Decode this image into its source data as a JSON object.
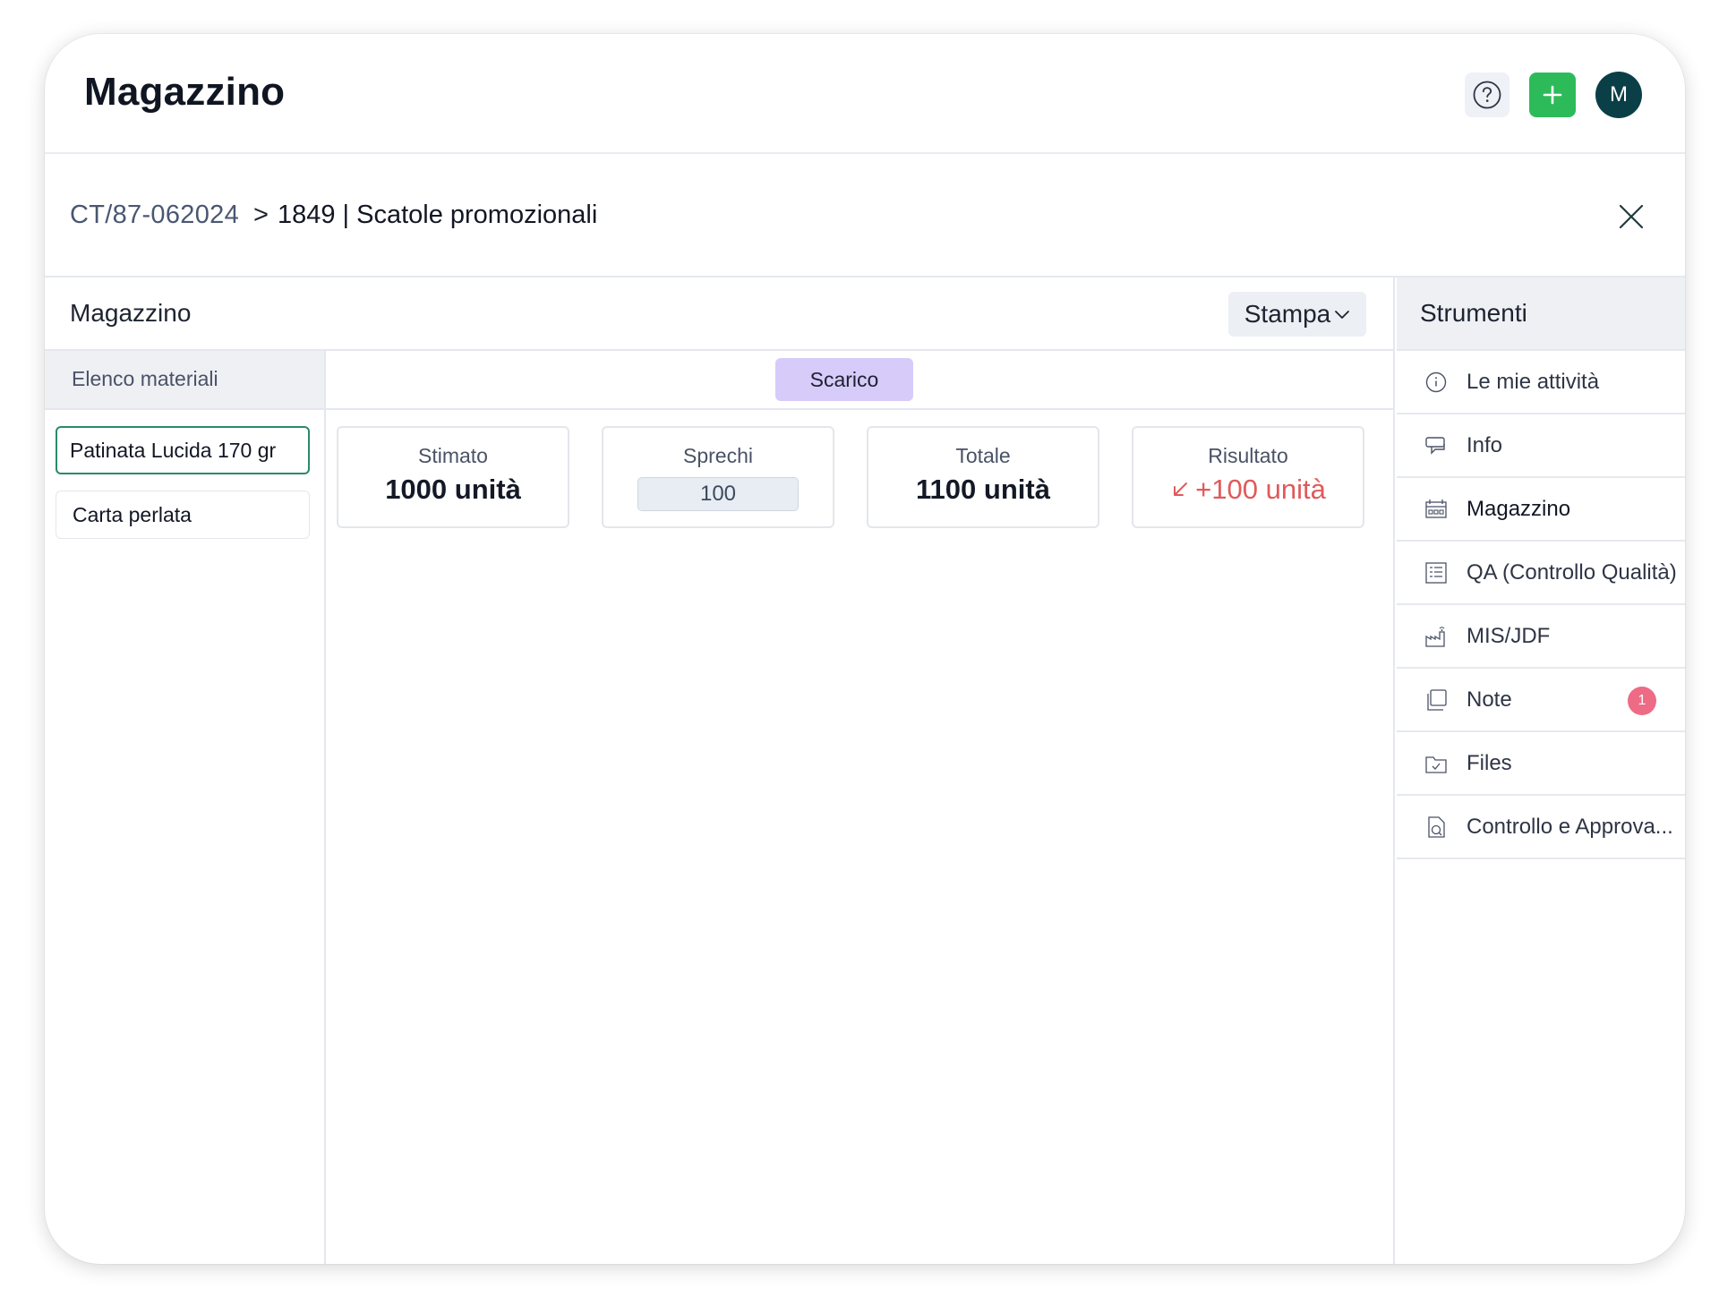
{
  "app": {
    "title": "Magazzino"
  },
  "header": {
    "avatar_initial": "M"
  },
  "breadcrumb": {
    "link": "CT/87-062024",
    "separator": ">",
    "current": "1849 | Scatole promozionali"
  },
  "main": {
    "title": "Magazzino",
    "stampa_label": "Stampa",
    "materials_header": "Elenco materiali",
    "materials": [
      {
        "label": "Patinata Lucida 170 gr",
        "active": true
      },
      {
        "label": "Carta perlata",
        "active": false
      }
    ],
    "tab": "Scarico",
    "stats": {
      "stimato": {
        "label": "Stimato",
        "value": "1000 unità"
      },
      "sprechi": {
        "label": "Sprechi",
        "value": "100"
      },
      "totale": {
        "label": "Totale",
        "value": "1100 unità"
      },
      "risultato": {
        "label": "Risultato",
        "value": "+100 unità",
        "color": "#e05a5a"
      }
    }
  },
  "tools": {
    "title": "Strumenti",
    "items": [
      {
        "label": "Le mie attività",
        "icon": "info-circle-icon"
      },
      {
        "label": "Info",
        "icon": "chat-icon"
      },
      {
        "label": "Magazzino",
        "icon": "warehouse-icon",
        "current": true
      },
      {
        "label": "QA (Controllo Qualità)",
        "icon": "checklist-icon"
      },
      {
        "label": "MIS/JDF",
        "icon": "factory-icon"
      },
      {
        "label": "Note",
        "icon": "note-icon",
        "badge": "1"
      },
      {
        "label": "Files",
        "icon": "folder-icon"
      },
      {
        "label": "Controllo e Approva...",
        "icon": "file-search-icon"
      }
    ]
  },
  "colors": {
    "accent_green": "#2dbb5a",
    "avatar": "#0b3f47",
    "tab_purple": "#d7cbfa",
    "badge": "#ee6b86"
  }
}
